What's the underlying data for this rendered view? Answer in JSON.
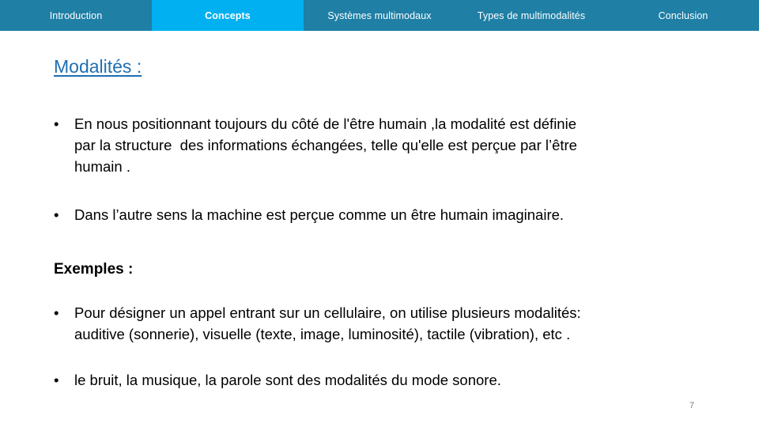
{
  "navbar": {
    "background_color": "#1F7FA5",
    "active_color": "#00B0F0",
    "items": [
      {
        "label": "Introduction",
        "active": false
      },
      {
        "label": "Concepts",
        "active": true
      },
      {
        "label": "Systèmes multimodaux",
        "active": false
      },
      {
        "label": "Types de multimodalités",
        "active": false
      },
      {
        "label": "Conclusion",
        "active": false
      }
    ]
  },
  "slide": {
    "title": "Modalités :",
    "title_color": "#1F6FB2",
    "subtitle": "Exemples :",
    "bullet_marker": "•",
    "bullets": [
      {
        "lines": [
          "En nous positionnant toujours du côté de l'être humain ,la modalité est définie",
          "par la structure  des informations échangées, telle qu'elle est perçue par l’être",
          "humain ."
        ]
      },
      {
        "lines": [
          "Dans l’autre sens la machine est perçue comme un être humain imaginaire."
        ]
      }
    ],
    "example_bullets": [
      {
        "lines": [
          "Pour désigner un appel entrant sur un cellulaire, on utilise plusieurs modalités:",
          "auditive (sonnerie), visuelle (texte, image, luminosité), tactile (vibration), etc ."
        ]
      },
      {
        "lines": [
          "le bruit, la musique, la parole sont des modalités du mode sonore."
        ]
      }
    ],
    "page_number": "7"
  }
}
